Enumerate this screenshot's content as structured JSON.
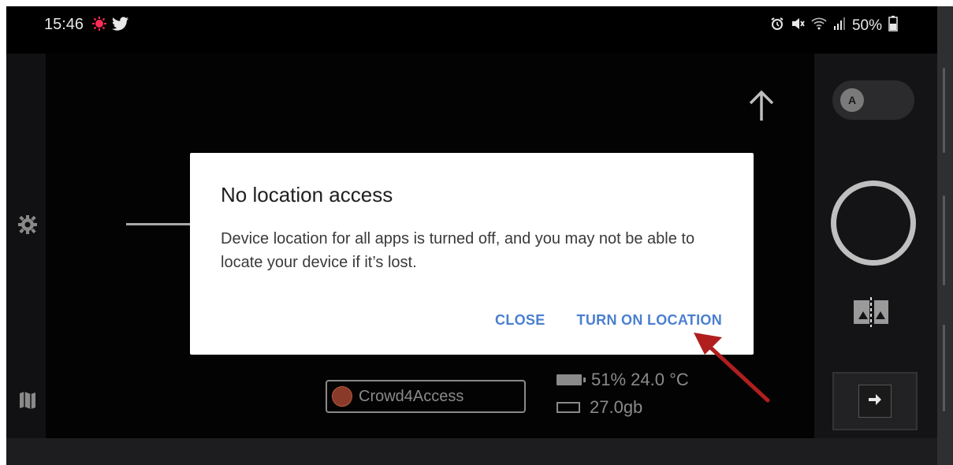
{
  "status_bar": {
    "time": "15:46",
    "battery_percent": "50%",
    "notification_icons": [
      "alert-icon",
      "twitter-icon"
    ],
    "system_icons": [
      "alarm-icon",
      "mute-icon",
      "wifi-icon",
      "signal-icon",
      "battery-icon"
    ]
  },
  "camera": {
    "auto_toggle_label": "A",
    "app_name": "Crowd4Access",
    "battery_info": "51%  24.0 °C",
    "storage_info": "27.0gb"
  },
  "dialog": {
    "title": "No location access",
    "message": "Device location for all apps is turned off, and you may not be able to locate your device if it’s lost.",
    "close_label": "CLOSE",
    "turn_on_label": "TURN ON LOCATION"
  },
  "colors": {
    "accent": "#4a7fd0",
    "annotation_arrow": "#b01e1e",
    "app_dot": "#8a3a28"
  }
}
